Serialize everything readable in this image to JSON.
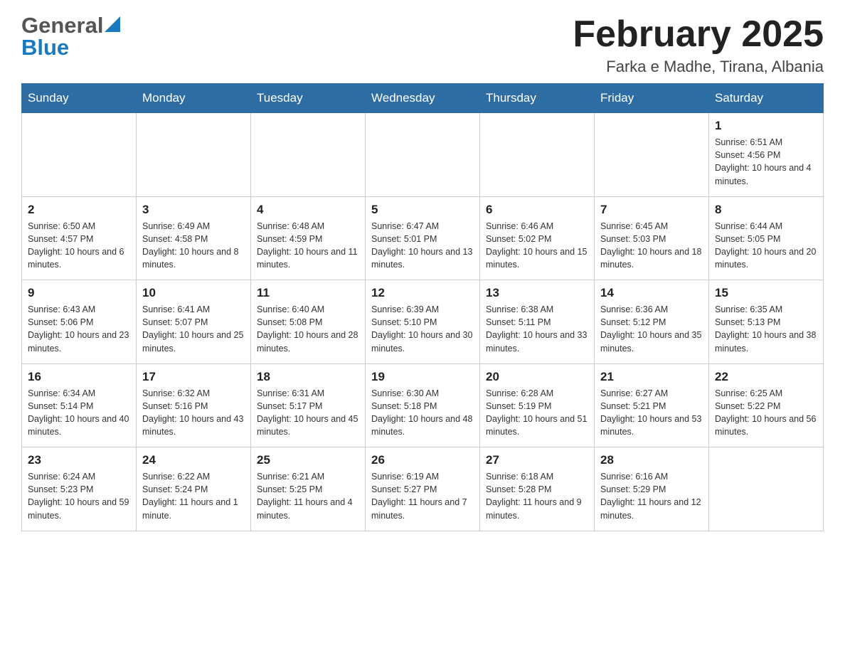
{
  "logo": {
    "line1": "General",
    "triangle_color": "#1a7abf",
    "line2": "Blue"
  },
  "header": {
    "month_year": "February 2025",
    "location": "Farka e Madhe, Tirana, Albania"
  },
  "weekdays": [
    "Sunday",
    "Monday",
    "Tuesday",
    "Wednesday",
    "Thursday",
    "Friday",
    "Saturday"
  ],
  "weeks": [
    [
      {
        "day": "",
        "info": ""
      },
      {
        "day": "",
        "info": ""
      },
      {
        "day": "",
        "info": ""
      },
      {
        "day": "",
        "info": ""
      },
      {
        "day": "",
        "info": ""
      },
      {
        "day": "",
        "info": ""
      },
      {
        "day": "1",
        "info": "Sunrise: 6:51 AM\nSunset: 4:56 PM\nDaylight: 10 hours and 4 minutes."
      }
    ],
    [
      {
        "day": "2",
        "info": "Sunrise: 6:50 AM\nSunset: 4:57 PM\nDaylight: 10 hours and 6 minutes."
      },
      {
        "day": "3",
        "info": "Sunrise: 6:49 AM\nSunset: 4:58 PM\nDaylight: 10 hours and 8 minutes."
      },
      {
        "day": "4",
        "info": "Sunrise: 6:48 AM\nSunset: 4:59 PM\nDaylight: 10 hours and 11 minutes."
      },
      {
        "day": "5",
        "info": "Sunrise: 6:47 AM\nSunset: 5:01 PM\nDaylight: 10 hours and 13 minutes."
      },
      {
        "day": "6",
        "info": "Sunrise: 6:46 AM\nSunset: 5:02 PM\nDaylight: 10 hours and 15 minutes."
      },
      {
        "day": "7",
        "info": "Sunrise: 6:45 AM\nSunset: 5:03 PM\nDaylight: 10 hours and 18 minutes."
      },
      {
        "day": "8",
        "info": "Sunrise: 6:44 AM\nSunset: 5:05 PM\nDaylight: 10 hours and 20 minutes."
      }
    ],
    [
      {
        "day": "9",
        "info": "Sunrise: 6:43 AM\nSunset: 5:06 PM\nDaylight: 10 hours and 23 minutes."
      },
      {
        "day": "10",
        "info": "Sunrise: 6:41 AM\nSunset: 5:07 PM\nDaylight: 10 hours and 25 minutes."
      },
      {
        "day": "11",
        "info": "Sunrise: 6:40 AM\nSunset: 5:08 PM\nDaylight: 10 hours and 28 minutes."
      },
      {
        "day": "12",
        "info": "Sunrise: 6:39 AM\nSunset: 5:10 PM\nDaylight: 10 hours and 30 minutes."
      },
      {
        "day": "13",
        "info": "Sunrise: 6:38 AM\nSunset: 5:11 PM\nDaylight: 10 hours and 33 minutes."
      },
      {
        "day": "14",
        "info": "Sunrise: 6:36 AM\nSunset: 5:12 PM\nDaylight: 10 hours and 35 minutes."
      },
      {
        "day": "15",
        "info": "Sunrise: 6:35 AM\nSunset: 5:13 PM\nDaylight: 10 hours and 38 minutes."
      }
    ],
    [
      {
        "day": "16",
        "info": "Sunrise: 6:34 AM\nSunset: 5:14 PM\nDaylight: 10 hours and 40 minutes."
      },
      {
        "day": "17",
        "info": "Sunrise: 6:32 AM\nSunset: 5:16 PM\nDaylight: 10 hours and 43 minutes."
      },
      {
        "day": "18",
        "info": "Sunrise: 6:31 AM\nSunset: 5:17 PM\nDaylight: 10 hours and 45 minutes."
      },
      {
        "day": "19",
        "info": "Sunrise: 6:30 AM\nSunset: 5:18 PM\nDaylight: 10 hours and 48 minutes."
      },
      {
        "day": "20",
        "info": "Sunrise: 6:28 AM\nSunset: 5:19 PM\nDaylight: 10 hours and 51 minutes."
      },
      {
        "day": "21",
        "info": "Sunrise: 6:27 AM\nSunset: 5:21 PM\nDaylight: 10 hours and 53 minutes."
      },
      {
        "day": "22",
        "info": "Sunrise: 6:25 AM\nSunset: 5:22 PM\nDaylight: 10 hours and 56 minutes."
      }
    ],
    [
      {
        "day": "23",
        "info": "Sunrise: 6:24 AM\nSunset: 5:23 PM\nDaylight: 10 hours and 59 minutes."
      },
      {
        "day": "24",
        "info": "Sunrise: 6:22 AM\nSunset: 5:24 PM\nDaylight: 11 hours and 1 minute."
      },
      {
        "day": "25",
        "info": "Sunrise: 6:21 AM\nSunset: 5:25 PM\nDaylight: 11 hours and 4 minutes."
      },
      {
        "day": "26",
        "info": "Sunrise: 6:19 AM\nSunset: 5:27 PM\nDaylight: 11 hours and 7 minutes."
      },
      {
        "day": "27",
        "info": "Sunrise: 6:18 AM\nSunset: 5:28 PM\nDaylight: 11 hours and 9 minutes."
      },
      {
        "day": "28",
        "info": "Sunrise: 6:16 AM\nSunset: 5:29 PM\nDaylight: 11 hours and 12 minutes."
      },
      {
        "day": "",
        "info": ""
      }
    ]
  ]
}
